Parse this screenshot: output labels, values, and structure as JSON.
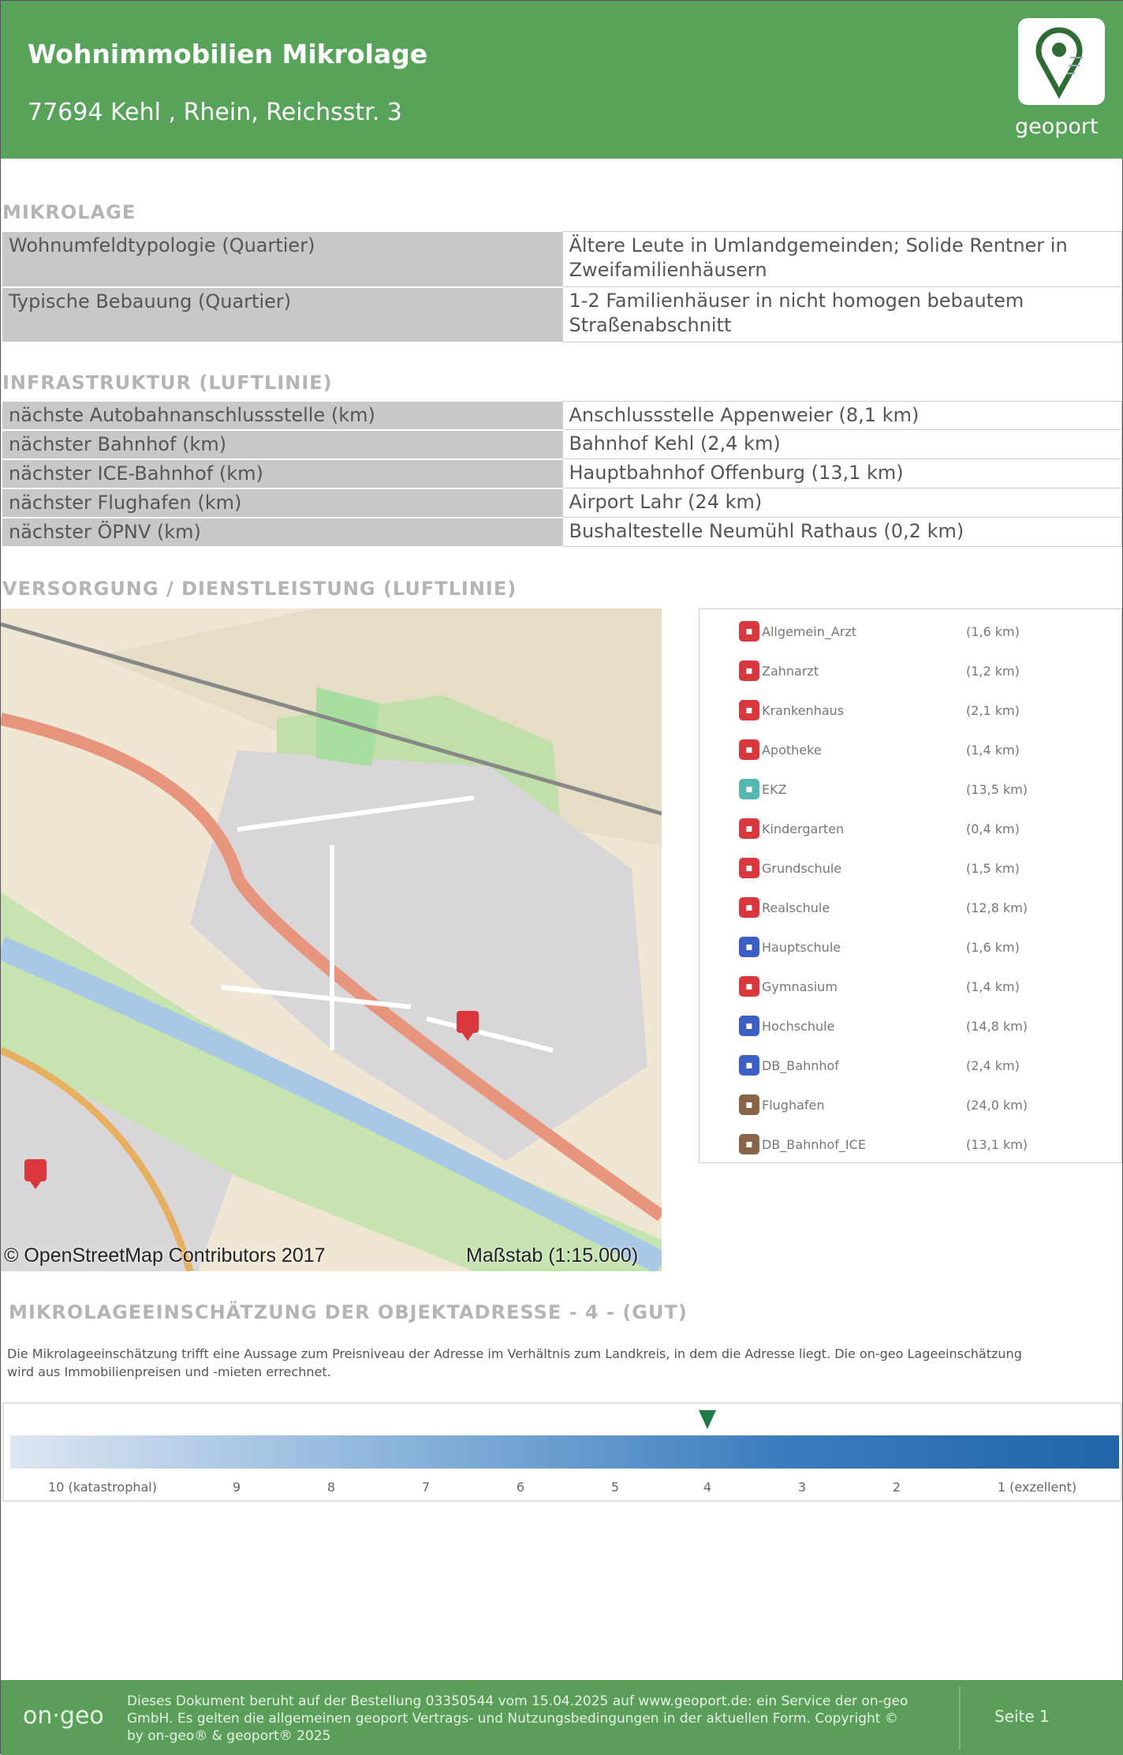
{
  "header": {
    "title": "Wohnimmobilien Mikrolage",
    "address": "77694 Kehl , Rhein, Reichsstr. 3",
    "logo_text": "geoport"
  },
  "mikrolage": {
    "heading": "MIKROLAGE",
    "rows": [
      {
        "label": "Wohnumfeldtypologie (Quartier)",
        "value": "Ältere Leute in Umlandgemeinden; Solide Rentner in Zweifamilienhäusern"
      },
      {
        "label": "Typische Bebauung (Quartier)",
        "value": "1-2 Familienhäuser in nicht homogen bebautem Straßenabschnitt"
      }
    ]
  },
  "infrastruktur": {
    "heading": "INFRASTRUKTUR (LUFTLINIE)",
    "rows": [
      {
        "label": "nächste Autobahnanschlussstelle (km)",
        "value": "Anschlussstelle Appenweier (8,1 km)"
      },
      {
        "label": "nächster Bahnhof (km)",
        "value": "Bahnhof Kehl (2,4 km)"
      },
      {
        "label": "nächster ICE-Bahnhof (km)",
        "value": "Hauptbahnhof Offenburg (13,1 km)"
      },
      {
        "label": "nächster Flughafen (km)",
        "value": "Airport Lahr (24 km)"
      },
      {
        "label": "nächster ÖPNV (km)",
        "value": "Bushaltestelle Neumühl Rathaus (0,2 km)"
      }
    ]
  },
  "versorgung": {
    "heading": "VERSORGUNG / DIENSTLEISTUNG (LUFTLINIE)",
    "map": {
      "copyright": "© OpenStreetMap Contributors 2017",
      "scale": "Maßstab (1:15.000)"
    },
    "legend": [
      {
        "label": "Allgemein_Arzt",
        "distance": "(1,6 km)",
        "color": "#d8383c"
      },
      {
        "label": "Zahnarzt",
        "distance": "(1,2 km)",
        "color": "#d8383c"
      },
      {
        "label": "Krankenhaus",
        "distance": "(2,1 km)",
        "color": "#d8383c"
      },
      {
        "label": "Apotheke",
        "distance": "(1,4 km)",
        "color": "#d8383c"
      },
      {
        "label": "EKZ",
        "distance": "(13,5 km)",
        "color": "#55b8b0"
      },
      {
        "label": "Kindergarten",
        "distance": "(0,4 km)",
        "color": "#d8383c"
      },
      {
        "label": "Grundschule",
        "distance": "(1,5 km)",
        "color": "#d8383c"
      },
      {
        "label": "Realschule",
        "distance": "(12,8 km)",
        "color": "#d8383c"
      },
      {
        "label": "Hauptschule",
        "distance": "(1,6 km)",
        "color": "#3b5fc4"
      },
      {
        "label": "Gymnasium",
        "distance": "(1,4 km)",
        "color": "#d8383c"
      },
      {
        "label": "Hochschule",
        "distance": "(14,8 km)",
        "color": "#3b5fc4"
      },
      {
        "label": "DB_Bahnhof",
        "distance": "(2,4 km)",
        "color": "#3b5fc4"
      },
      {
        "label": "Flughafen",
        "distance": "(24,0 km)",
        "color": "#8a6448"
      },
      {
        "label": "DB_Bahnhof_ICE",
        "distance": "(13,1 km)",
        "color": "#8a6448"
      }
    ]
  },
  "einschaetzung": {
    "heading": "MIKROLAGEEINSCHÄTZUNG DER OBJEKTADRESSE - 4 - (GUT)",
    "description": "Die Mikrolageeinschätzung trifft eine Aussage zum Preisniveau der Adresse im Verhältnis zum Landkreis, in dem die Adresse liegt. Die on-geo Lageeinschätzung wird aus Immobilienpreisen und -mieten errechnet.",
    "score": 4,
    "labels": [
      "10 (katastrophal)",
      "9",
      "8",
      "7",
      "6",
      "5",
      "4",
      "3",
      "2",
      "1 (exzellent)"
    ]
  },
  "footer": {
    "logo": "on·geo",
    "text": "Dieses Dokument beruht auf der Bestellung 03350544 vom 15.04.2025 auf www.geoport.de: ein Service der on-geo GmbH. Es gelten die allgemeinen geoport Vertrags- und Nutzungsbedingungen in der aktuellen Form. Copyright © by on-geo® & geoport® 2025",
    "page": "Seite 1"
  }
}
